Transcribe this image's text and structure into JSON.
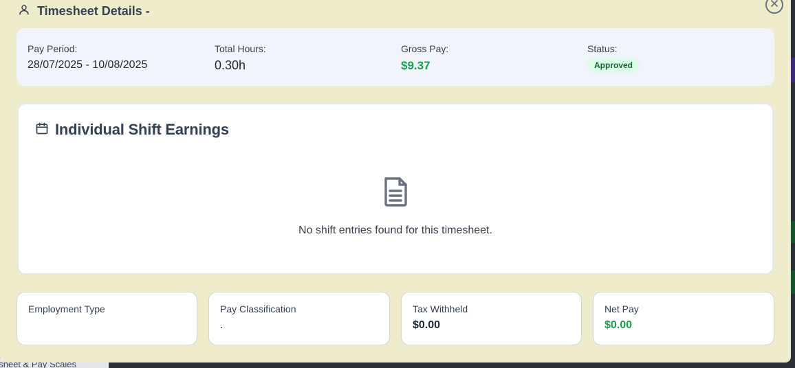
{
  "background": {
    "tab_label": "esheet & Pay Scales"
  },
  "modal": {
    "title": "Timesheet Details -",
    "icons": {
      "title": "user-icon",
      "close": "close-icon"
    }
  },
  "summary": {
    "pay_period": {
      "label": "Pay Period:",
      "value": "28/07/2025 - 10/08/2025"
    },
    "total_hours": {
      "label": "Total Hours:",
      "value": "0.30h"
    },
    "gross_pay": {
      "label": "Gross Pay:",
      "value": "$9.37"
    },
    "status": {
      "label": "Status:",
      "value": "Approved"
    }
  },
  "shifts": {
    "title": "Individual Shift Earnings",
    "icon": "calendar-icon",
    "empty_icon": "document-icon",
    "empty_message": "No shift entries found for this timesheet."
  },
  "cards": [
    {
      "label": "Employment Type",
      "value": ""
    },
    {
      "label": "Pay Classification",
      "value": "."
    },
    {
      "label": "Tax Withheld",
      "value": "$0.00"
    },
    {
      "label": "Net Pay",
      "value": "$0.00"
    }
  ],
  "colors": {
    "modal_bg": "#efeccb",
    "summary_bg": "#f1f5fb",
    "accent_green": "#16a34a",
    "badge_bg": "#dcfce7"
  }
}
